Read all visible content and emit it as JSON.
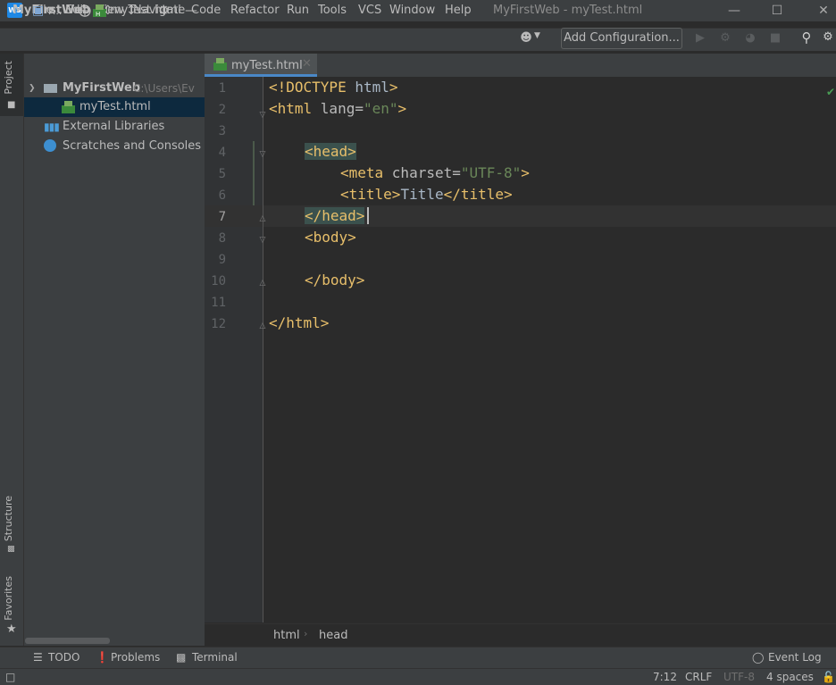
{
  "menu": {
    "items": [
      "File",
      "Edit",
      "View",
      "Navigate",
      "Code",
      "Refactor",
      "Run",
      "Tools",
      "VCS",
      "Window",
      "Help"
    ],
    "window_title": "MyFirstWeb - myTest.html"
  },
  "nav": {
    "project": "MyFirstWeb",
    "file": "myTest.html",
    "add_configuration": "Add Configuration..."
  },
  "side_tabs": {
    "project": "Project",
    "structure": "Structure",
    "favorites": "Favorites"
  },
  "project_panel": {
    "view_label": "P...",
    "tree": [
      {
        "label": "MyFirstWeb",
        "hint": "C:\\Users\\Ev",
        "kind": "root"
      },
      {
        "label": "myTest.html",
        "kind": "file",
        "selected": true
      },
      {
        "label": "External Libraries",
        "kind": "libs"
      },
      {
        "label": "Scratches and Consoles",
        "kind": "scratch"
      }
    ]
  },
  "editor": {
    "tab": "myTest.html",
    "line_numbers": [
      "1",
      "2",
      "3",
      "4",
      "5",
      "6",
      "7",
      "8",
      "9",
      "10",
      "11",
      "12"
    ],
    "current_line": "7"
  },
  "breadcrumb": [
    "html",
    "head"
  ],
  "bottom_tools": {
    "todo": "TODO",
    "problems": "Problems",
    "terminal": "Terminal",
    "event_log": "Event Log"
  },
  "status": {
    "position": "7:12",
    "line_sep": "CRLF",
    "encoding": "UTF-8",
    "indent": "4 spaces"
  }
}
